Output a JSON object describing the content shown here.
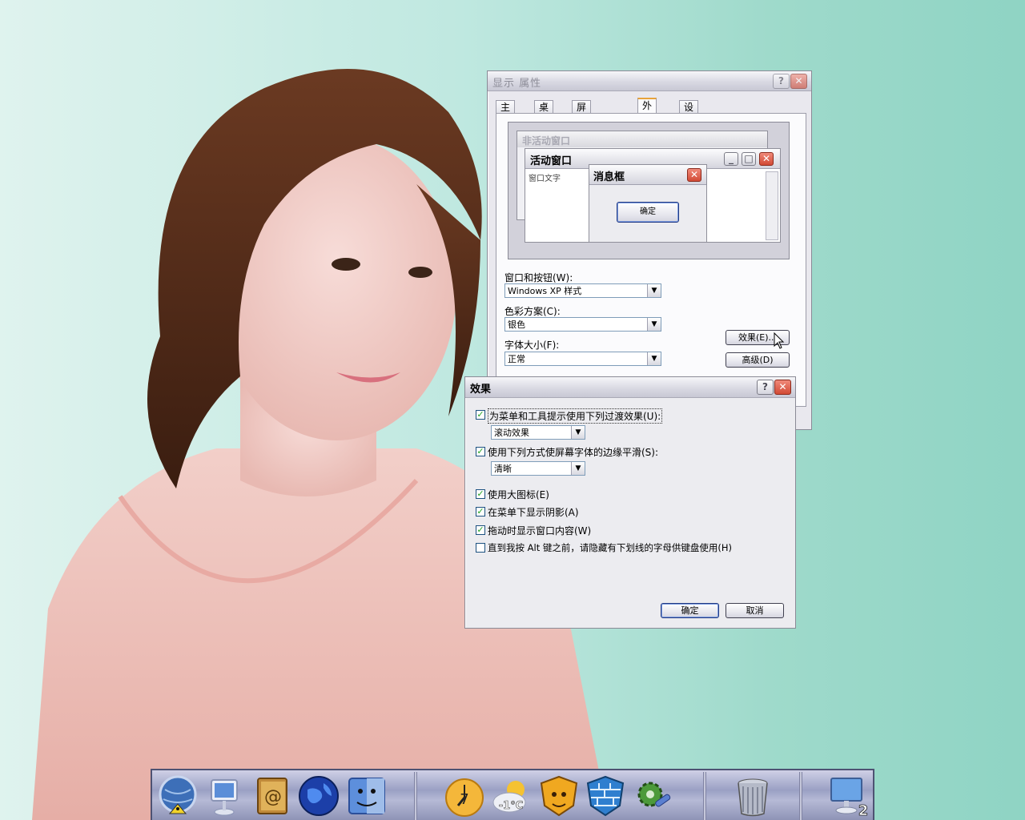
{
  "display_properties": {
    "title": "显示 属性",
    "help_btn": "?",
    "close_btn": "✕",
    "tabs": [
      "主题",
      "桌面",
      "屏幕保护程序",
      "外观",
      "设置"
    ],
    "active_tab": "外观",
    "preview": {
      "inactive_title": "非活动窗口",
      "active_title": "活动窗口",
      "window_text": "窗口文字",
      "msgbox_title": "消息框",
      "ok_label": "确定"
    },
    "windows_buttons_label": "窗口和按钮(W):",
    "windows_buttons_value": "Windows XP 样式",
    "color_scheme_label": "色彩方案(C):",
    "color_scheme_value": "银色",
    "font_size_label": "字体大小(F):",
    "font_size_value": "正常",
    "effects_btn": "效果(E)...",
    "advanced_btn": "高级(D)"
  },
  "effects_dialog": {
    "title": "效果",
    "help_btn": "?",
    "close_btn": "✕",
    "options": [
      {
        "label": "为菜单和工具提示使用下列过渡效果(U):",
        "checked": true
      },
      {
        "label": "使用下列方式使屏幕字体的边缘平滑(S):",
        "checked": true
      },
      {
        "label": "使用大图标(E)",
        "checked": true
      },
      {
        "label": "在菜单下显示阴影(A)",
        "checked": true
      },
      {
        "label": "拖动时显示窗口内容(W)",
        "checked": true
      },
      {
        "label": "直到我按 Alt 键之前，请隐藏有下划线的字母供键盘使用(H)",
        "checked": false
      }
    ],
    "transition_value": "滚动效果",
    "smoothing_value": "清晰",
    "ok_btn": "确定",
    "cancel_btn": "取消"
  },
  "dock": {
    "weather_temp": "-1°C",
    "clock_hour": "7",
    "desktop_badge": "2"
  }
}
